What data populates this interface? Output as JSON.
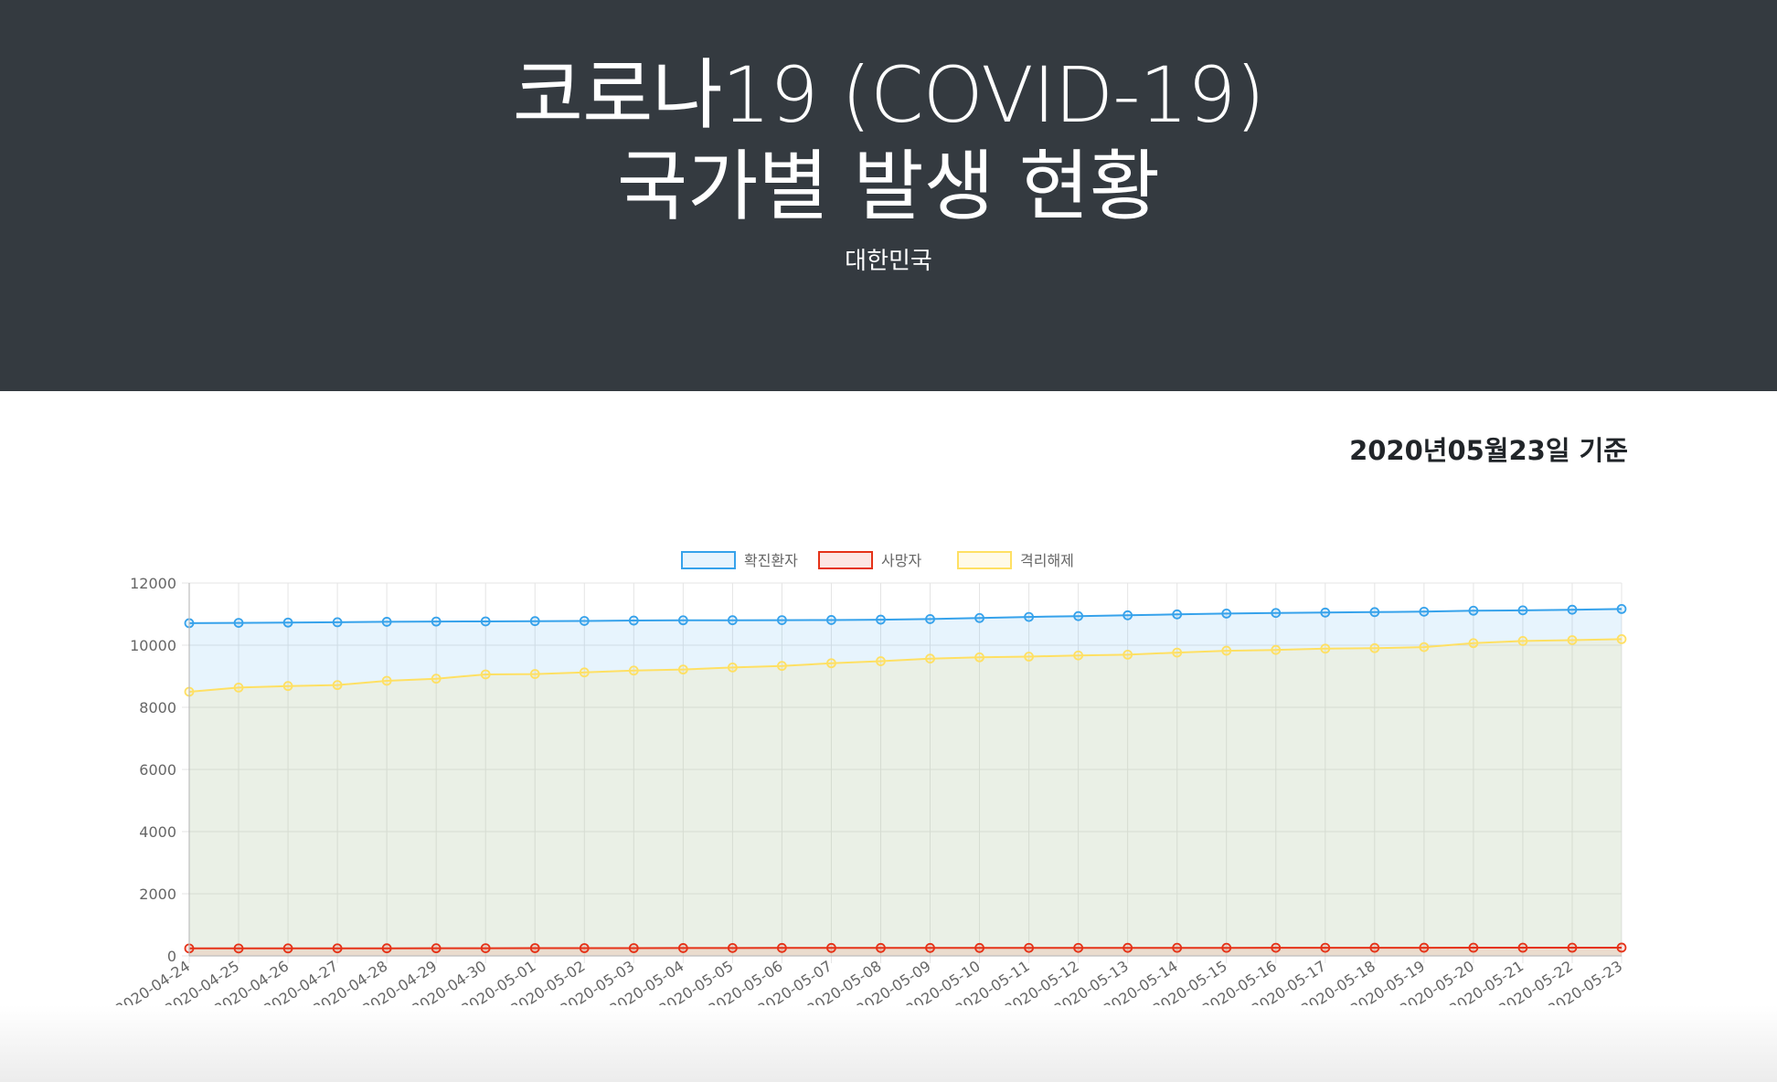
{
  "header": {
    "title_line1": "코로나19 (COVID-19)",
    "title_line2": "국가별 발생 현황",
    "country": "대한민국"
  },
  "as_of": "2020년05월23일 기준",
  "chart_data": {
    "type": "line",
    "categories": [
      "2020-04-24",
      "2020-04-25",
      "2020-04-26",
      "2020-04-27",
      "2020-04-28",
      "2020-04-29",
      "2020-04-30",
      "2020-05-01",
      "2020-05-02",
      "2020-05-03",
      "2020-05-04",
      "2020-05-05",
      "2020-05-06",
      "2020-05-07",
      "2020-05-08",
      "2020-05-09",
      "2020-05-10",
      "2020-05-11",
      "2020-05-12",
      "2020-05-13",
      "2020-05-14",
      "2020-05-15",
      "2020-05-16",
      "2020-05-17",
      "2020-05-18",
      "2020-05-19",
      "2020-05-20",
      "2020-05-21",
      "2020-05-22",
      "2020-05-23"
    ],
    "ylim": [
      0,
      12000
    ],
    "yticks": [
      0,
      2000,
      4000,
      6000,
      8000,
      10000,
      12000
    ],
    "grid": true,
    "legend_position": "top",
    "series": [
      {
        "name": "확진환자",
        "color": "#36a2eb",
        "fill": "rgba(54,162,235,0.12)",
        "values": [
          10708,
          10718,
          10728,
          10738,
          10752,
          10761,
          10765,
          10774,
          10780,
          10793,
          10801,
          10804,
          10806,
          10810,
          10822,
          10840,
          10874,
          10909,
          10936,
          10962,
          10991,
          11018,
          11037,
          11050,
          11065,
          11078,
          11110,
          11122,
          11142,
          11165
        ]
      },
      {
        "name": "사망자",
        "color": "#e53218",
        "fill": "rgba(229,50,24,0.12)",
        "values": [
          240,
          240,
          242,
          243,
          244,
          246,
          247,
          250,
          250,
          250,
          252,
          254,
          255,
          256,
          256,
          256,
          256,
          258,
          258,
          259,
          260,
          260,
          262,
          262,
          263,
          263,
          264,
          264,
          264,
          266
        ]
      },
      {
        "name": "격리해제",
        "color": "#ffe063",
        "fill": "rgba(255,224,99,0.15)",
        "values": [
          8501,
          8635,
          8686,
          8717,
          8854,
          8922,
          9059,
          9072,
          9123,
          9183,
          9217,
          9283,
          9333,
          9419,
          9484,
          9568,
          9610,
          9632,
          9670,
          9695,
          9762,
          9821,
          9847,
          9888,
          9904,
          9938,
          10066,
          10135,
          10162,
          10194
        ]
      }
    ]
  }
}
